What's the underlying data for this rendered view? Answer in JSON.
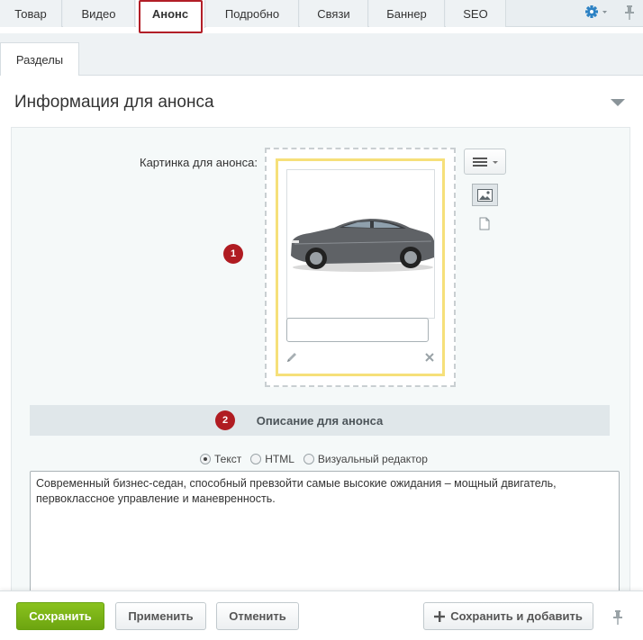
{
  "tabs": [
    {
      "label": "Товар"
    },
    {
      "label": "Видео"
    },
    {
      "label": "Анонс",
      "active": true
    },
    {
      "label": "Подробно"
    },
    {
      "label": "Связи"
    },
    {
      "label": "Баннер"
    },
    {
      "label": "SEO"
    }
  ],
  "subtabs": [
    {
      "label": "Разделы"
    }
  ],
  "section": {
    "title": "Информация для анонса"
  },
  "picture": {
    "label": "Картинка для анонса:",
    "description_value": "",
    "badge": "1"
  },
  "description": {
    "header": "Описание для анонса",
    "badge": "2",
    "modes": [
      {
        "label": "Текст",
        "checked": true
      },
      {
        "label": "HTML",
        "checked": false
      },
      {
        "label": "Визуальный редактор",
        "checked": false
      }
    ],
    "text": "Современный бизнес-седан, способный превзойти самые высокие ожидания – мощный двигатель, первоклассное управление и маневренность."
  },
  "footer": {
    "save": "Сохранить",
    "apply": "Применить",
    "cancel": "Отменить",
    "save_add": "Сохранить и добавить"
  },
  "colors": {
    "accent_green": "#7ab616",
    "highlight_red": "#b21e27",
    "gear_blue": "#2d82c4",
    "file_border_yellow": "#f6e07a"
  }
}
